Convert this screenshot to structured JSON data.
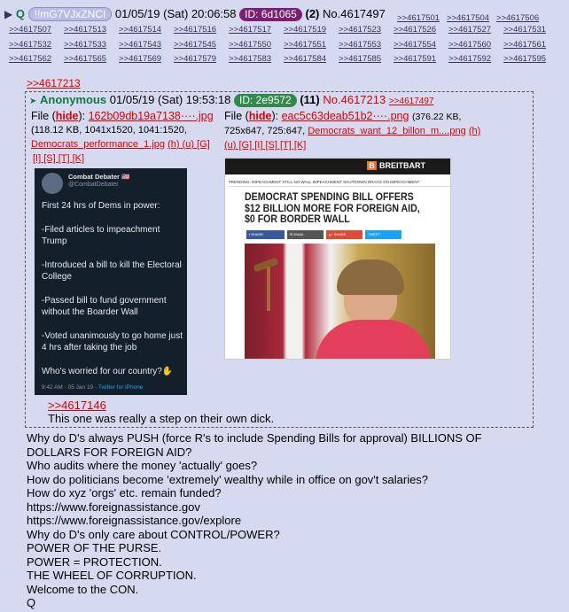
{
  "op": {
    "arrow": "▶",
    "name": "Q",
    "tripcode": "!!mG7VJxZNCI",
    "date": "01/05/19 (Sat) 20:06:58",
    "id_label": "ID: 6d1065",
    "id_count": "(2)",
    "post_no": "No.4617497"
  },
  "backlinks": [
    ">>4617501",
    ">>4617504",
    ">>4617506",
    ">>4617507",
    ">>4617513",
    ">>4617514",
    ">>4617516",
    ">>4617517",
    ">>4617519",
    ">>4617523",
    ">>4617526",
    ">>4617527",
    ">>4617531",
    ">>4617532",
    ">>4617533",
    ">>4617543",
    ">>4617545",
    ">>4617550",
    ">>4617551",
    ">>4617553",
    ">>4617554",
    ">>4617560",
    ">>4617561",
    ">>4617562",
    ">>4617565",
    ">>4617569",
    ">>4617579",
    ">>4617583",
    ">>4617584",
    ">>4617585",
    ">>4617591",
    ">>4617592",
    ">>4617595"
  ],
  "quote_link": ">>4617213",
  "reply": {
    "name": "Anonymous",
    "date": "01/05/19 (Sat) 19:53:18",
    "id_label": "ID: 2e9572",
    "id_count": "(11)",
    "post_no": "No.4617213",
    "backlink": ">>4617497",
    "file1": {
      "label": "File (",
      "hide": "hide",
      "label_close": "):",
      "filename": "162b09db19a7138····.jpg",
      "meta": "(118.12 KB, 1041x1520, 1041:1520,",
      "orig": "Democrats_performance_1.jpg",
      "links_a": "(h) (u) [G]",
      "links_b": "[I] [S] [T] [K]"
    },
    "file2": {
      "label": "File (",
      "hide": "hide",
      "label_close": "):",
      "filename": "eac5c63deab51b2····.png",
      "meta_a": "(376.22 KB,",
      "meta_b": "725x647, 725:647,",
      "orig": "Democrats_want_12_billon_m....png",
      "link_h": "(h)",
      "links_b": "(u) [G] [I] [S] [T] [K]"
    },
    "tweet": {
      "user": "Combat Debater 🇺🇸",
      "handle": "@CombatDebater",
      "lines": [
        "First 24 hrs of Dems in power:",
        "-Filed articles to impeachment Trump",
        "-Introduced a bill to kill the Electoral College",
        "-Passed bill to fund government without the Boarder Wall",
        "-Voted unanimously to go home just 4 hrs after taking the job",
        "Who's worried for our country?✋"
      ],
      "footer": "9:42 AM · 05 Jan 19 · ",
      "footer_app": "Twitter for iPhone"
    },
    "article": {
      "brand": "BREITBART",
      "nav": "TRENDING:   IMPEACHMENT   STILL NO WALL   IMPEACHMENT   SHUTDOWN DRAGS ON   IMPEACHMENT",
      "headline": "DEMOCRAT SPENDING BILL OFFERS $12 BILLION MORE FOR FOREIGN AID, $0 FOR BORDER WALL",
      "share_buttons": [
        "f SHARE",
        "✉ EMAIL",
        "g+ SHARE",
        "TWEET"
      ]
    },
    "body_link": ">>4617146",
    "body_text": "This one was really a step on their own dick."
  },
  "body_lines": [
    "Why do D's always PUSH (force R's to include Spending Bills for approval) BILLIONS OF",
    "DOLLARS FOR FOREIGN AID?",
    "Who audits where the money 'actually' goes?",
    "How do politicians become 'extremely' wealthy while in office on gov't salaries?",
    "How do xyz 'orgs' etc. remain funded?",
    "https://www.foreignassistance.gov",
    "https://www.foreignassistance.gov/explore",
    "Why do D's only care about CONTROL/POWER?",
    "POWER OF THE PURSE.",
    "POWER = PROTECTION.",
    "THE WHEEL OF CORRUPTION.",
    "Welcome to the CON.",
    "Q"
  ],
  "colors": {
    "background": "#d6daf0",
    "name_green": "#117743",
    "op_id_badge": "#7a1f72",
    "reply_id_badge": "#2f8a4c",
    "link_red": "#dd0000",
    "link_blue": "#34345c"
  }
}
